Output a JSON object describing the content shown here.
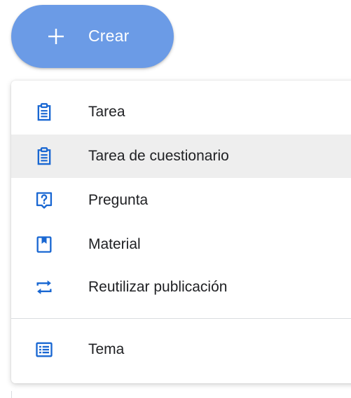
{
  "create_button": {
    "label": "Crear",
    "icon": "plus-icon"
  },
  "menu": {
    "items": [
      {
        "label": "Tarea",
        "icon": "assignment-icon",
        "highlighted": false
      },
      {
        "label": "Tarea de cuestionario",
        "icon": "quiz-assignment-icon",
        "highlighted": true
      },
      {
        "label": "Pregunta",
        "icon": "question-icon",
        "highlighted": false
      },
      {
        "label": "Material",
        "icon": "material-bookmark-icon",
        "highlighted": false
      },
      {
        "label": "Reutilizar publicación",
        "icon": "reuse-post-icon",
        "highlighted": false
      }
    ],
    "topic": {
      "label": "Tema",
      "icon": "topic-list-icon"
    }
  },
  "colors": {
    "accent": "#1967d2",
    "button_bg": "#6b9be6",
    "highlight": "#eeeeee",
    "text": "#202124"
  }
}
